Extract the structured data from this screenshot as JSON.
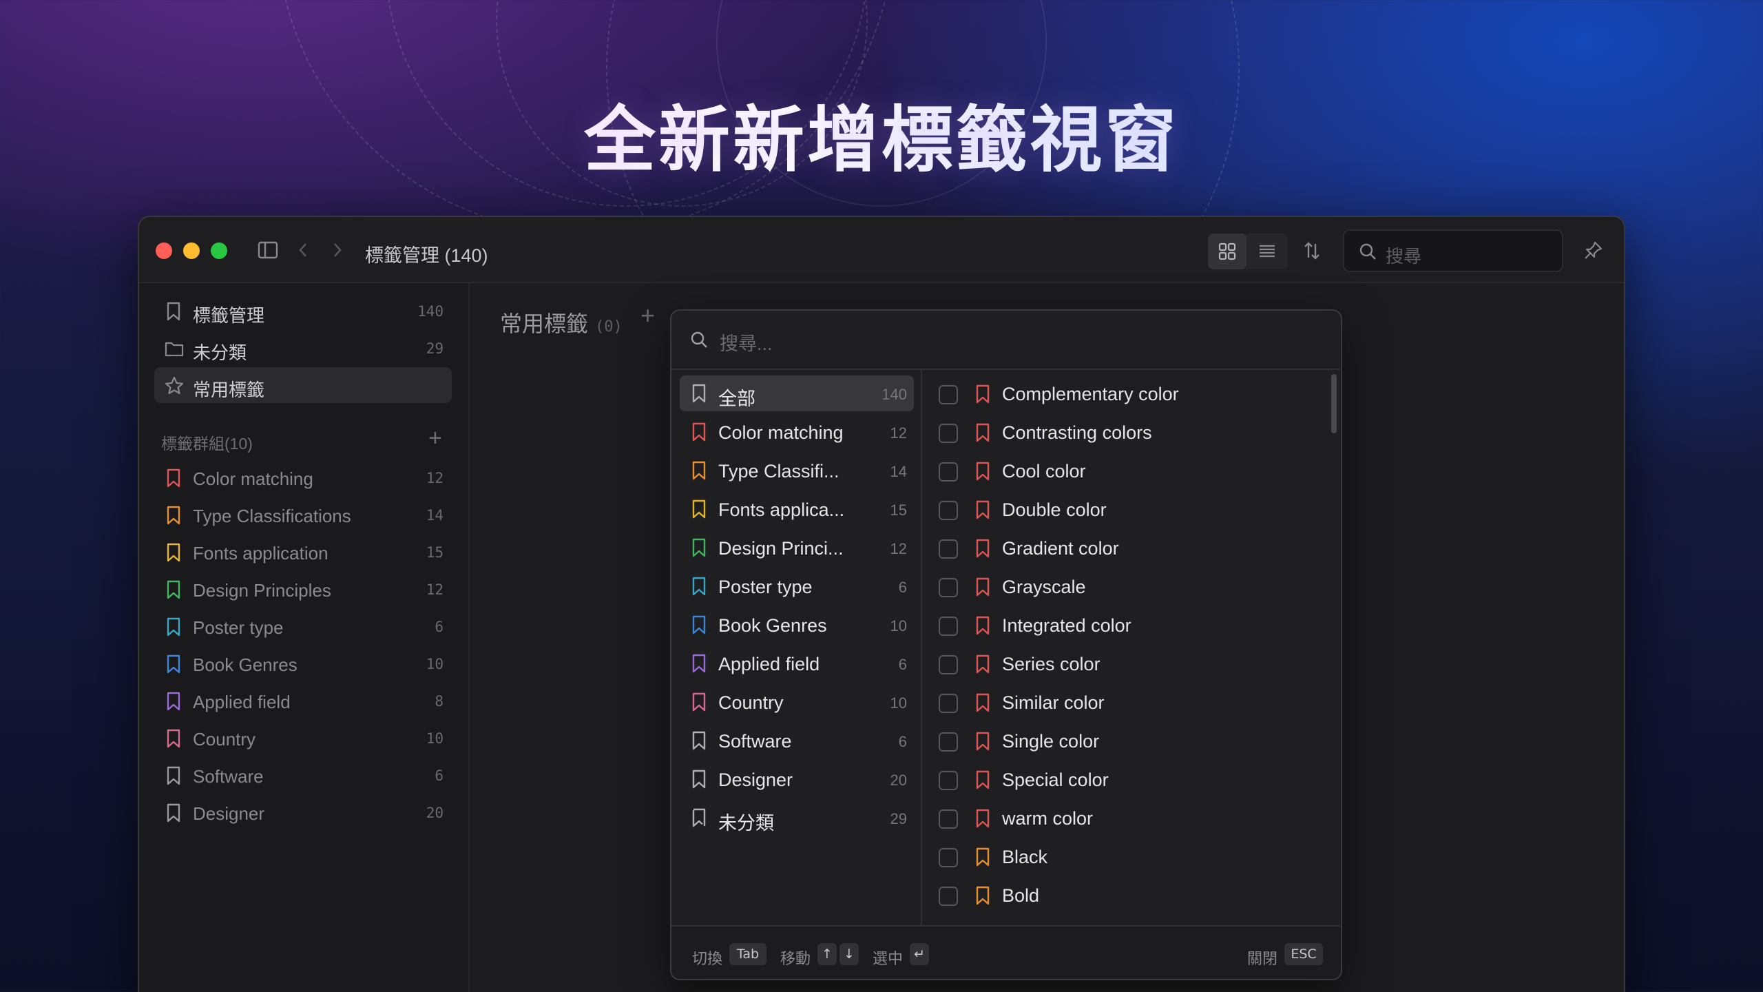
{
  "headline": "全新新增標籤視窗",
  "window": {
    "title": "標籤管理 (140)",
    "search_placeholder": "搜尋"
  },
  "sidebar": {
    "top_items": [
      {
        "label": "標籤管理",
        "count": "140",
        "icon": "bookmark-icon"
      },
      {
        "label": "未分類",
        "count": "29",
        "icon": "folder-icon"
      },
      {
        "label": "常用標籤",
        "count": "",
        "icon": "star-icon"
      }
    ],
    "group_header": "標籤群組(10)",
    "groups": [
      {
        "label": "Color matching",
        "count": "12",
        "color": "#e05555"
      },
      {
        "label": "Type Classifications",
        "count": "14",
        "color": "#e8902f"
      },
      {
        "label": "Fonts application",
        "count": "15",
        "color": "#e7b52c"
      },
      {
        "label": "Design Principles",
        "count": "12",
        "color": "#3fb860"
      },
      {
        "label": "Poster type",
        "count": "6",
        "color": "#37a8c8"
      },
      {
        "label": "Book Genres",
        "count": "10",
        "color": "#3a86d8"
      },
      {
        "label": "Applied field",
        "count": "8",
        "color": "#9a6ad8"
      },
      {
        "label": "Country",
        "count": "10",
        "color": "#d86a8e"
      },
      {
        "label": "Software",
        "count": "6",
        "color": "#9a9a9e"
      },
      {
        "label": "Designer",
        "count": "20",
        "color": "#9a9a9e"
      }
    ]
  },
  "main": {
    "heading": "常用標籤",
    "heading_count": "(0)"
  },
  "popup": {
    "search_placeholder": "搜尋...",
    "left": [
      {
        "label": "全部",
        "count": "140",
        "color": "#b0b0b4"
      },
      {
        "label": "Color matching",
        "count": "12",
        "color": "#e05555"
      },
      {
        "label": "Type Classifi...",
        "count": "14",
        "color": "#e8902f"
      },
      {
        "label": "Fonts applica...",
        "count": "15",
        "color": "#e7b52c"
      },
      {
        "label": "Design Princi...",
        "count": "12",
        "color": "#3fb860"
      },
      {
        "label": "Poster type",
        "count": "6",
        "color": "#37a8c8"
      },
      {
        "label": "Book Genres",
        "count": "10",
        "color": "#3a86d8"
      },
      {
        "label": "Applied field",
        "count": "6",
        "color": "#9a6ad8"
      },
      {
        "label": "Country",
        "count": "10",
        "color": "#d86a8e"
      },
      {
        "label": "Software",
        "count": "6",
        "color": "#b0b0b4"
      },
      {
        "label": "Designer",
        "count": "20",
        "color": "#b0b0b4"
      },
      {
        "label": "未分類",
        "count": "29",
        "color": "#b0b0b4"
      }
    ],
    "right": [
      {
        "label": "Complementary color",
        "color": "#e05555"
      },
      {
        "label": "Contrasting colors",
        "color": "#e05555"
      },
      {
        "label": "Cool color",
        "color": "#e05555"
      },
      {
        "label": "Double color",
        "color": "#e05555"
      },
      {
        "label": "Gradient color",
        "color": "#e05555"
      },
      {
        "label": "Grayscale",
        "color": "#e05555"
      },
      {
        "label": "Integrated color",
        "color": "#e05555"
      },
      {
        "label": "Series color",
        "color": "#e05555"
      },
      {
        "label": "Similar color",
        "color": "#e05555"
      },
      {
        "label": "Single color",
        "color": "#e05555"
      },
      {
        "label": "Special color",
        "color": "#e05555"
      },
      {
        "label": "warm color",
        "color": "#e05555"
      },
      {
        "label": "Black",
        "color": "#e8902f"
      },
      {
        "label": "Bold",
        "color": "#e8902f"
      }
    ],
    "footer": {
      "switch_label": "切換",
      "switch_key": "Tab",
      "move_label": "移動",
      "move_up": "↑",
      "move_down": "↓",
      "select_label": "選中",
      "select_key": "↵",
      "close_label": "關閉",
      "close_key": "ESC"
    }
  },
  "colors": {
    "traffic_red": "#ff5f57",
    "traffic_yellow": "#febc2e",
    "traffic_green": "#28c840"
  }
}
